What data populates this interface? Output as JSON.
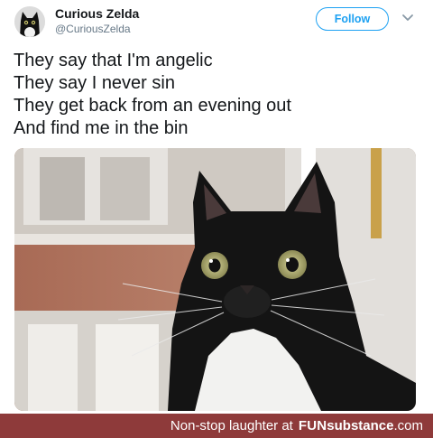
{
  "tweet": {
    "display_name": "Curious Zelda",
    "handle": "@CuriousZelda",
    "follow_label": "Follow",
    "text_lines": [
      "They say that I'm angelic",
      "They say I never sin",
      "They get back from an evening out",
      "And find me in the bin"
    ]
  },
  "footer": {
    "caption": "Non-stop laughter at",
    "brand_prefix": "FUN",
    "brand_main": "substance",
    "brand_suffix": ".com"
  },
  "colors": {
    "accent": "#1da1f2",
    "footer_bg": "#8e3a3a",
    "name_text": "#14171a",
    "handle_text": "#657786"
  },
  "icons": {
    "menu": "chevron-down-icon"
  }
}
